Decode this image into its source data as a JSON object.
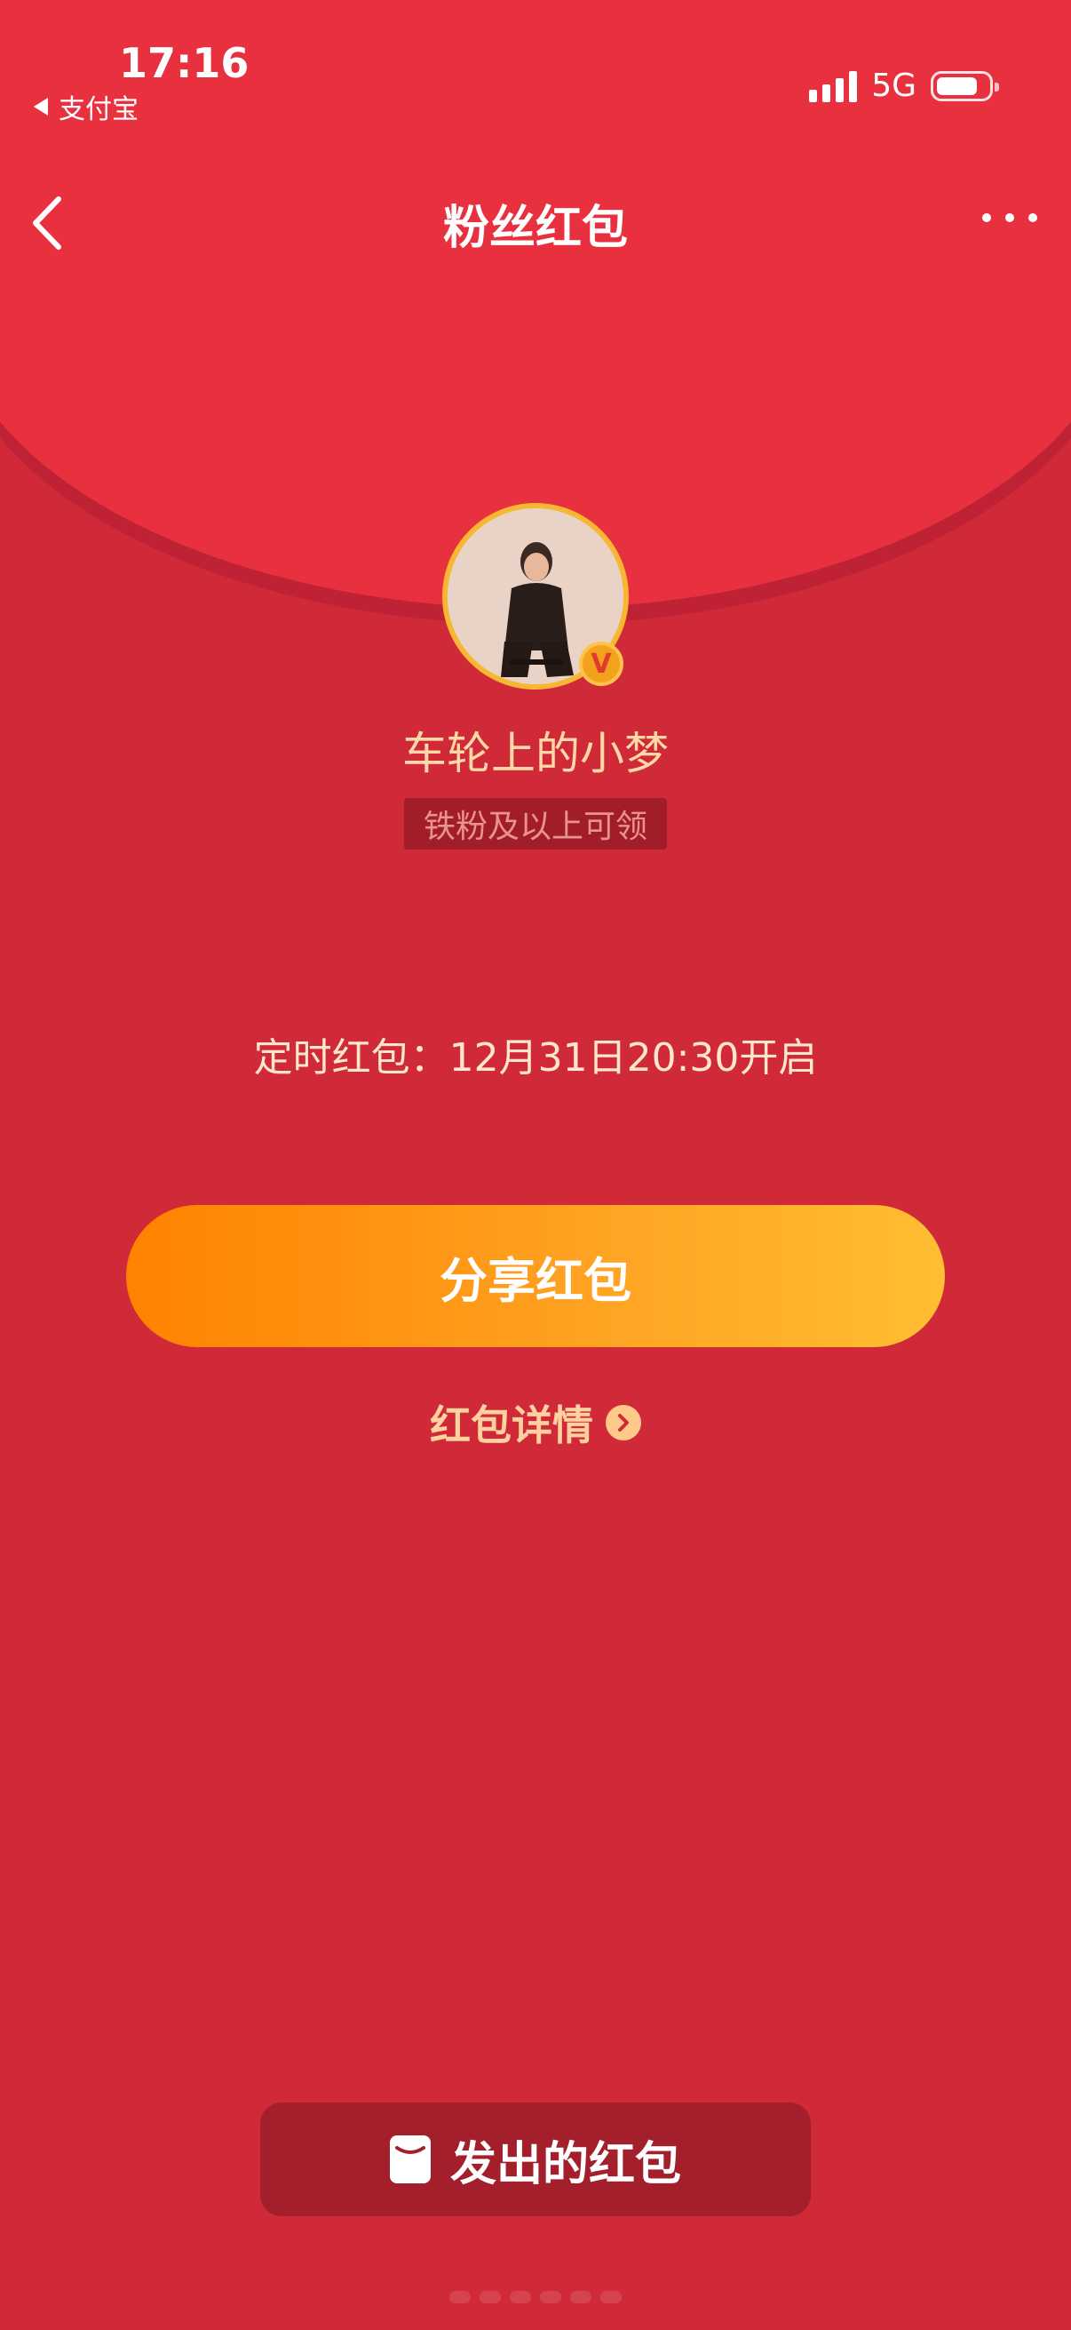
{
  "status_bar": {
    "time": "17:16",
    "back_app": "支付宝",
    "network": "5G",
    "battery_level": 0.8
  },
  "nav": {
    "title": "粉丝红包",
    "back_icon": "chevron-left-icon",
    "more_icon": "more-dots-icon"
  },
  "profile": {
    "username": "车轮上的小梦",
    "verified_badge": "V",
    "eligibility": "铁粉及以上可领"
  },
  "envelope": {
    "timer_text": "定时红包：12月31日20:30开启",
    "share_label": "分享红包",
    "details_label": "红包详情"
  },
  "footer": {
    "sent_label": "发出的红包"
  },
  "colors": {
    "background": "#D02A38",
    "header": "#E8303F",
    "accent_gold": "#F7B733",
    "button_start": "#FF8200",
    "button_end": "#FFBE33"
  }
}
